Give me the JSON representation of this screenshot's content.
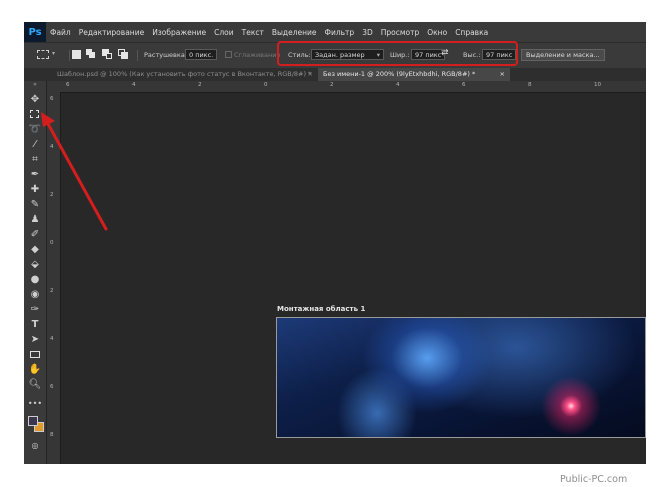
{
  "app": {
    "logo": "Ps"
  },
  "menu": [
    "Файл",
    "Редактирование",
    "Изображение",
    "Слои",
    "Текст",
    "Выделение",
    "Фильтр",
    "3D",
    "Просмотр",
    "Окно",
    "Справка"
  ],
  "options": {
    "feather_label": "Растушевка:",
    "feather_value": "0 пикс.",
    "antialias_label": "Сглаживание",
    "style_label": "Стиль:",
    "style_value": "Задан. размер",
    "width_label": "Шир.:",
    "width_value": "97 пикс",
    "height_label": "Выс.:",
    "height_value": "97 пикс",
    "mask_button": "Выделение и маска..."
  },
  "tabs": [
    {
      "label": "Шаблон.psd @ 100% (Как установить фото статус в Вконтакте, RGB/8#) *",
      "close": "×",
      "active": false
    },
    {
      "label": "Без имени-1 @ 200% (9lyEtxhbdhi, RGB/8#) *",
      "close": "×",
      "active": true
    }
  ],
  "ruler_top": [
    "6",
    "4",
    "2",
    "0",
    "2",
    "4",
    "6",
    "8",
    "10"
  ],
  "ruler_left": [
    "6",
    "4",
    "2",
    "0",
    "2",
    "4",
    "6",
    "8"
  ],
  "artboard": {
    "label": "Монтажная область 1"
  },
  "colors": {
    "accent_red": "#d41e1e",
    "foreground": "#3c3550",
    "background": "#e09a2c"
  },
  "watermark": "Public-PC.com"
}
